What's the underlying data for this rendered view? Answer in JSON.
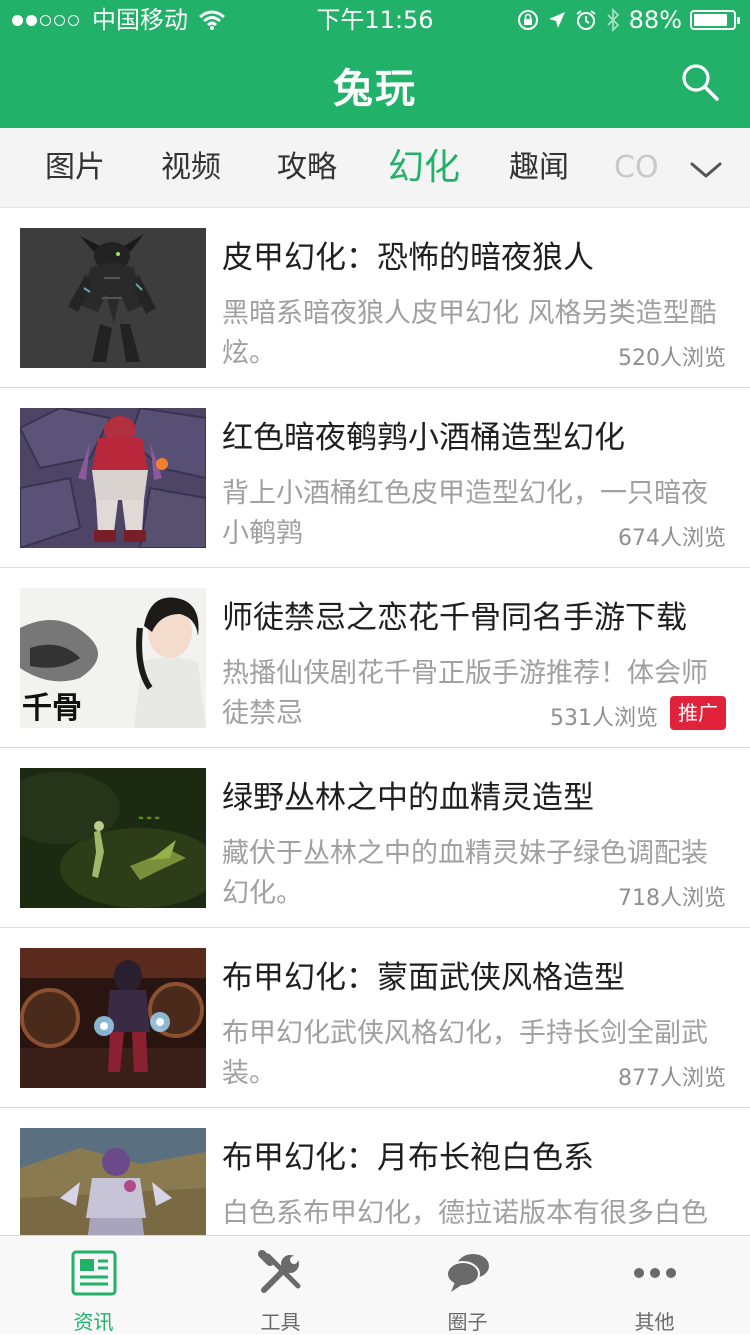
{
  "status_bar": {
    "carrier": "中国移动",
    "time": "下午11:56",
    "battery": "88%",
    "battery_level": 0.88
  },
  "header": {
    "title": "兔玩",
    "search_icon": "search-icon"
  },
  "tabs": {
    "items": [
      "图片",
      "视频",
      "攻略",
      "幻化",
      "趣闻",
      "CO"
    ],
    "active": "幻化",
    "more_icon": "chevron-down-icon"
  },
  "articles": [
    {
      "title": "皮甲幻化：恐怖的暗夜狼人",
      "desc": "黑暗系暗夜狼人皮甲幻化 风格另类造型酷炫。",
      "views": "520人浏览"
    },
    {
      "title": "红色暗夜鹌鹑小酒桶造型幻化",
      "desc": "背上小酒桶红色皮甲造型幻化，一只暗夜小鹌鹑",
      "views": "674人浏览"
    },
    {
      "title": "师徒禁忌之恋花千骨同名手游下载",
      "desc": "热播仙侠剧花千骨正版手游推荐！体会师徒禁忌",
      "views": "531人浏览",
      "badge": "推广",
      "thumb_text": "千骨"
    },
    {
      "title": "绿野丛林之中的血精灵造型",
      "desc": "藏伏于丛林之中的血精灵妹子绿色调配装幻化。",
      "views": "718人浏览"
    },
    {
      "title": "布甲幻化：蒙面武侠风格造型",
      "desc": "布甲幻化武侠风格幻化，手持长剑全副武装。",
      "views": "877人浏览"
    },
    {
      "title": "布甲幻化：月布长袍白色系",
      "desc": "白色系布甲幻化，德拉诺版本有很多白色",
      "views": ""
    }
  ],
  "tabbar": {
    "items": [
      {
        "label": "资讯",
        "icon": "news-icon"
      },
      {
        "label": "工具",
        "icon": "tools-icon"
      },
      {
        "label": "圈子",
        "icon": "chat-icon"
      },
      {
        "label": "其他",
        "icon": "more-icon"
      }
    ],
    "active": "资讯"
  },
  "colors": {
    "brand": "#22b169",
    "badge": "#e0233b"
  }
}
